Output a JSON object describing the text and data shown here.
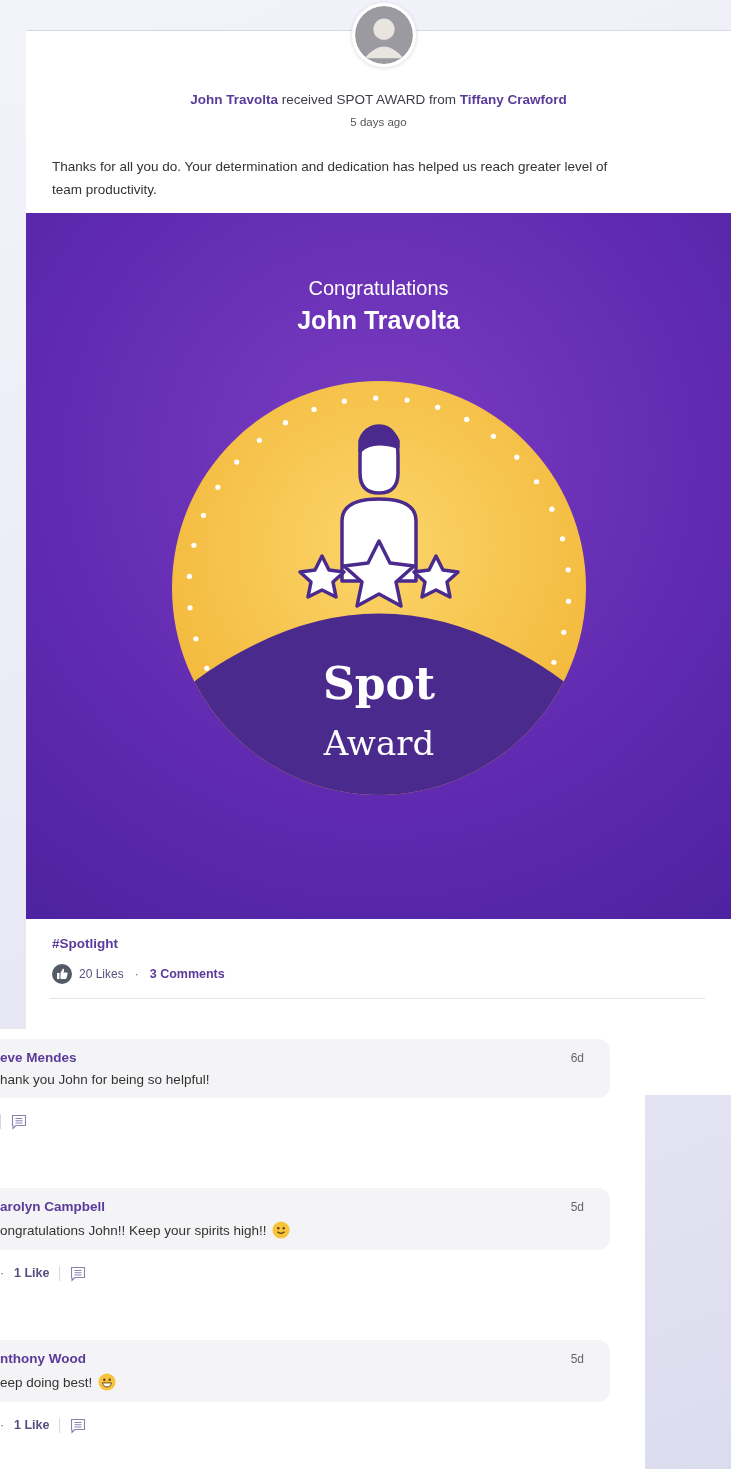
{
  "post": {
    "author": "John Travolta",
    "verb": "received SPOT AWARD from",
    "giver": "Tiffany Crawford",
    "time": "5 days ago",
    "message": "Thanks for all you do. Your determination and dedication has helped us reach greater level of team productivity.",
    "banner": {
      "greeting": "Congratulations",
      "recipient": "John Travolta",
      "badge_title": "Spot",
      "badge_subtitle": "Award"
    },
    "hashtag": "#Spotlight",
    "likes": "20 Likes",
    "dot": "·",
    "comments_count": "3 Comments"
  },
  "comments": [
    {
      "name": "eve Mendes",
      "time": "6d",
      "text": "hank you John for being so helpful!",
      "kind": "plain"
    },
    {
      "name": "arolyn Campbell",
      "time": "5d",
      "text": "ongratulations John!! Keep your spirits high!!",
      "kind": "smile",
      "dot": "·",
      "likes": "1 Like"
    },
    {
      "name": "nthony Wood",
      "time": "5d",
      "text": "eep doing best!",
      "kind": "grin",
      "dot": "·",
      "likes": "1 Like"
    }
  ]
}
